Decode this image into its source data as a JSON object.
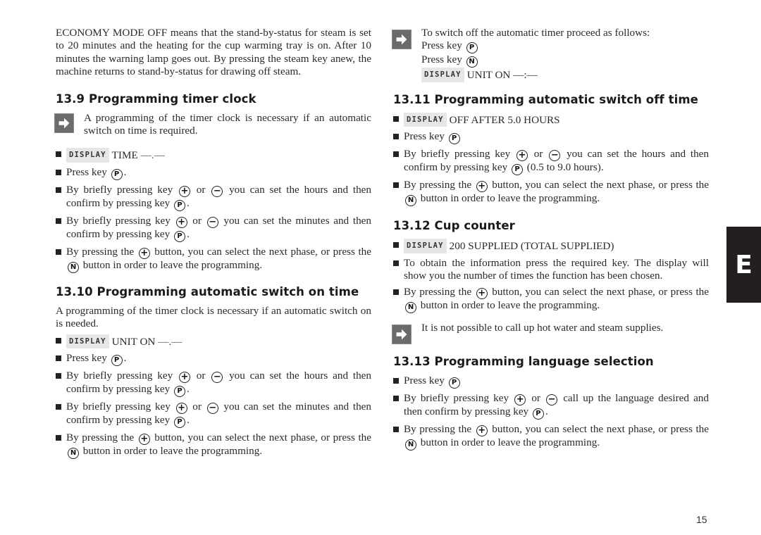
{
  "left": {
    "intro": "ECONOMY MODE OFF means that the stand-by-status for steam is set to 20 minutes and the heating for the cup warming tray is on. After 10 minutes the warning lamp goes out. By pressing the steam key anew, the machine returns to stand-by-status for drawing off steam.",
    "s139": {
      "title": "13.9 Programming timer clock",
      "note": "A programming of the timer clock is necessary if an automatic switch on time is required.",
      "display_tag": "DISPLAY",
      "display_text": "TIME",
      "display_value": "—.—",
      "press_key": "Press key",
      "hours_a": "By briefly pressing key",
      "or": "or",
      "hours_b": "you can set the hours and then confirm by pressing key",
      "minutes_b": "you can set the minutes and then confirm by pressing key",
      "next_a": "By pressing the",
      "next_b": "button, you can select the next phase, or press the",
      "next_c": "button in order to leave the programming."
    },
    "s1310": {
      "title": "13.10 Programming automatic switch on time",
      "intro": "A programming of the timer clock is necessary if an automatic switch on is needed.",
      "display_tag": "DISPLAY",
      "display_text": "UNIT ON",
      "display_value": "—.—",
      "press_key": "Press key",
      "hours_a": "By briefly pressing key",
      "or": "or",
      "hours_b": "you can set the hours and then confirm by pressing key",
      "minutes_b": "you can set the minutes and then confirm by pressing key",
      "next_a": "By pressing the",
      "next_b": "button, you can select the next phase, or press the",
      "next_c": "button in order to leave the programming."
    }
  },
  "right": {
    "switchoff_note": {
      "line1": "To switch off the automatic timer proceed as follows:",
      "line2": "Press key",
      "line3": "Press key",
      "display_tag": "DISPLAY",
      "display_text": "UNIT ON —:—"
    },
    "s1311": {
      "title": "13.11 Programming automatic switch off time",
      "display_tag": "DISPLAY",
      "display_text": "OFF AFTER 5.0 HOURS",
      "press_key": "Press key",
      "hours_a": "By briefly pressing key",
      "or": "or",
      "hours_b": "you can set the hours and then confirm by pressing key",
      "hours_c": "(0.5 to 9.0 hours).",
      "next_a": "By pressing the",
      "next_b": "button, you can select the next phase, or press the",
      "next_c": "button in order to leave the programming."
    },
    "s1312": {
      "title": "13.12 Cup counter",
      "display_tag": "DISPLAY",
      "display_text": "200 SUPPLIED (TOTAL SUPPLIED)",
      "info": "To obtain the information press the required key. The display will show you the number of times the function has been chosen.",
      "next_a": "By pressing the",
      "next_b": "button, you can select the next phase, or press the",
      "next_c": "button in order to leave the programming.",
      "note": "It is not possible to call up hot water and steam supplies."
    },
    "s1313": {
      "title": "13.13 Programming language selection",
      "press_key": "Press key",
      "lang_a": "By briefly pressing key",
      "or": "or",
      "lang_b": "call up the language desired and then confirm by pressing key",
      "next_a": "By pressing the",
      "next_b": "button, you can select the next phase, or press the",
      "next_c": "button in order to leave the programming."
    }
  },
  "keys": {
    "p": "P",
    "n": "N",
    "plus": "+",
    "minus": "−"
  },
  "punct": {
    "period": "."
  },
  "tab_letter": "E",
  "page_number": "15"
}
